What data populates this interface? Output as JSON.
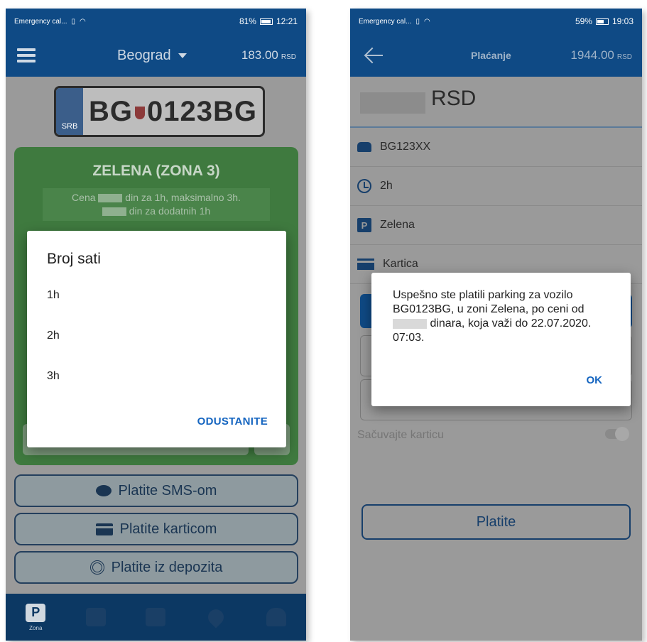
{
  "left": {
    "status": {
      "carrier": "Emergency cal...",
      "battery": "81%",
      "time": "12:21"
    },
    "header": {
      "city": "Beograd",
      "balance": "183.00",
      "currency": "RSD"
    },
    "plate": {
      "country": "SRB",
      "number_prefix": "BG",
      "number_suffix": "0123BG"
    },
    "zone": {
      "title": "ZELENA (ZONA 3)",
      "desc_line1_prefix": "Cena",
      "desc_line1_suffix": "din za 1h, maksimalno 3h.",
      "desc_line2_suffix": "din za dodatnih 1h"
    },
    "buttons": {
      "sms": "Platite SMS-om",
      "card": "Platite karticom",
      "deposit": "Platite iz depozita"
    },
    "nav": {
      "zone_label": "Zona"
    },
    "dialog": {
      "title": "Broj sati",
      "options": [
        "1h",
        "2h",
        "3h"
      ],
      "cancel": "ODUSTANITE"
    }
  },
  "right": {
    "status": {
      "carrier": "Emergency cal...",
      "battery": "59%",
      "time": "19:03"
    },
    "header": {
      "title": "Plaćanje",
      "balance": "1944.00",
      "currency": "RSD"
    },
    "amount_currency": "RSD",
    "rows": {
      "vehicle": "BG123XX",
      "duration": "2h",
      "zone": "Zelena",
      "method": "Kartica"
    },
    "save_card": "Sačuvajte karticu",
    "pay": "Platite",
    "dialog": {
      "msg_part1": "Uspešno ste platili parking za vozilo BG0123BG, u zoni Zelena, po ceni od",
      "msg_part2": "dinara, koja važi do 22.07.2020. 07:03.",
      "ok": "OK"
    }
  },
  "colors": {
    "brand_blue": "#0f4a85",
    "zone_green": "#3f7a3f",
    "accent_link": "#1565c0"
  }
}
